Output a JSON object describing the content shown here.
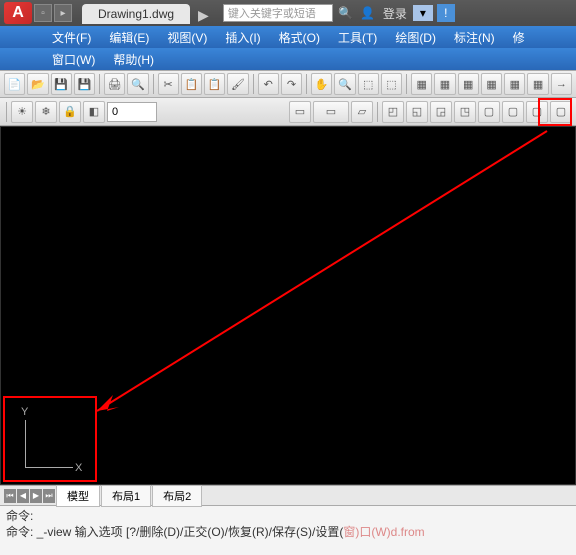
{
  "title": {
    "filename": "Drawing1.dwg",
    "search_placeholder": "键入关键字或短语",
    "login": "登录"
  },
  "menu": [
    "文件(F)",
    "编辑(E)",
    "视图(V)",
    "插入(I)",
    "格式(O)",
    "工具(T)",
    "绘图(D)",
    "标注(N)",
    "修"
  ],
  "menu2": [
    "窗口(W)",
    "帮助(H)"
  ],
  "layer": {
    "value": "0"
  },
  "ucs": {
    "x": "X",
    "y": "Y"
  },
  "layout": {
    "model": "模型",
    "l1": "布局1",
    "l2": "布局2"
  },
  "cmd": {
    "line1": "命令:",
    "line2_a": "命令: _-view 输入选项 [?/删除(D)/正交(O)/恢复(R)/保存(S)/设置(",
    "line2_b": "窗)口(W)d.from"
  }
}
